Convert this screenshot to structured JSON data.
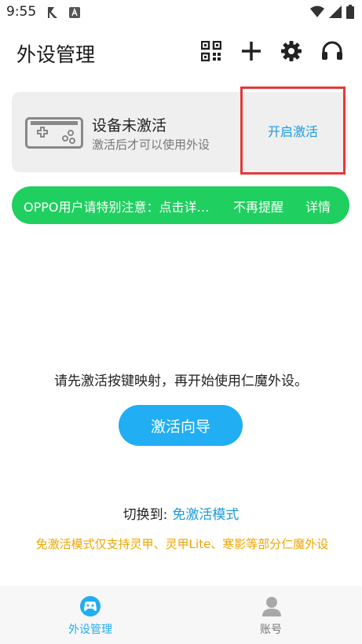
{
  "status_bar": {
    "time": "9:55"
  },
  "header": {
    "title": "外设管理",
    "icons": [
      "qr-code-icon",
      "plus-icon",
      "gear-icon",
      "headset-icon"
    ]
  },
  "device_card": {
    "title": "设备未激活",
    "subtitle": "激活后才可以使用外设",
    "activate_label": "开启激活"
  },
  "notice": {
    "text": "OPPO用户请特别注意：点击详…",
    "dismiss_label": "不再提醒",
    "detail_label": "详情"
  },
  "main": {
    "prompt": "请先激活按键映射，再开始使用仁魔外设。",
    "wizard_label": "激活向导",
    "switch_label": "切换到:",
    "switch_link": "免激活模式",
    "warning": "免激活模式仅支持灵甲、灵甲Lite、寒影等部分仁魔外设"
  },
  "tabs": [
    {
      "label": "外设管理",
      "active": true
    },
    {
      "label": "账号",
      "active": false
    }
  ],
  "colors": {
    "accent": "#21aef2",
    "notice_green": "#1fcf5f",
    "warning_orange": "#f0a500",
    "highlight_red": "#e53935"
  }
}
